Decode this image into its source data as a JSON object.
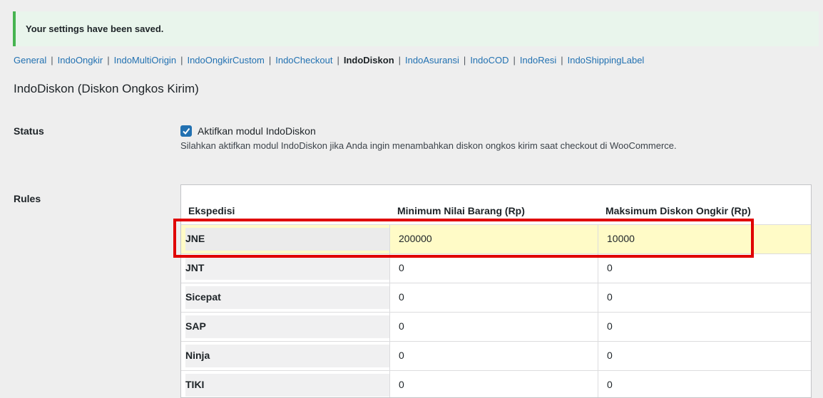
{
  "notice": {
    "text": "Your settings have been saved."
  },
  "subnav": {
    "items": [
      {
        "label": "General",
        "current": false
      },
      {
        "label": "IndoOngkir",
        "current": false
      },
      {
        "label": "IndoMultiOrigin",
        "current": false
      },
      {
        "label": "IndoOngkirCustom",
        "current": false
      },
      {
        "label": "IndoCheckout",
        "current": false
      },
      {
        "label": "IndoDiskon",
        "current": true
      },
      {
        "label": "IndoAsuransi",
        "current": false
      },
      {
        "label": "IndoCOD",
        "current": false
      },
      {
        "label": "IndoResi",
        "current": false
      },
      {
        "label": "IndoShippingLabel",
        "current": false
      }
    ],
    "separator": "|"
  },
  "page_title": "IndoDiskon (Diskon Ongkos Kirim)",
  "status": {
    "label": "Status",
    "checkbox_checked": true,
    "checkbox_label": "Aktifkan modul IndoDiskon",
    "description": "Silahkan aktifkan modul IndoDiskon jika Anda ingin menambahkan diskon ongkos kirim saat checkout di WooCommerce."
  },
  "rules": {
    "label": "Rules",
    "headers": [
      "Ekspedisi",
      "Minimum Nilai Barang (Rp)",
      "Maksimum Diskon Ongkir (Rp)"
    ],
    "rows": [
      {
        "courier": "JNE",
        "min": "200000",
        "max": "10000",
        "highlighted": true
      },
      {
        "courier": "JNT",
        "min": "0",
        "max": "0",
        "highlighted": false
      },
      {
        "courier": "Sicepat",
        "min": "0",
        "max": "0",
        "highlighted": false
      },
      {
        "courier": "SAP",
        "min": "0",
        "max": "0",
        "highlighted": false
      },
      {
        "courier": "Ninja",
        "min": "0",
        "max": "0",
        "highlighted": false
      },
      {
        "courier": "TIKI",
        "min": "0",
        "max": "0",
        "highlighted": false
      }
    ]
  },
  "colors": {
    "accent": "#2271b1",
    "highlight_row": "#fffbc7",
    "annotation_box": "#e00000",
    "notice_border": "#46b450"
  }
}
